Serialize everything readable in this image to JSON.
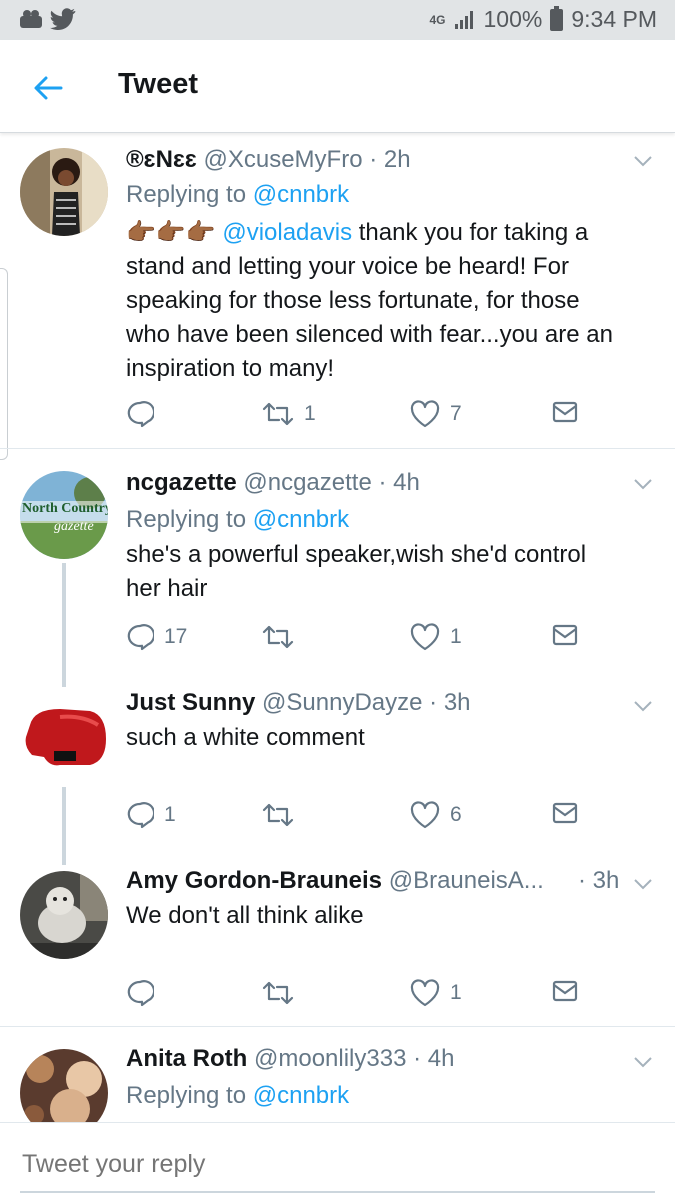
{
  "status_bar": {
    "network": "4G",
    "battery": "100%",
    "time": "9:34 PM"
  },
  "header": {
    "title": "Tweet"
  },
  "tweets": [
    {
      "name": "®ɛNɛɛ",
      "handle": "@XcuseMyFro",
      "time": "· 2h",
      "reply_prefix": "Replying to",
      "reply_to": "@cnnbrk",
      "emoji": "👉🏾👉🏾👉🏾",
      "mention": "@violadavis",
      "text_after_mention": " thank you for taking a",
      "text_lines": [
        "stand and letting your voice be heard! For",
        "speaking for those less fortunate, for those",
        "who have been silenced with fear...you are an",
        "inspiration to many!"
      ],
      "reply_count": "",
      "retweet_count": "1",
      "like_count": "7"
    },
    {
      "name": "ncgazette",
      "handle": "@ncgazette",
      "time": "· 4h",
      "reply_prefix": "Replying to",
      "reply_to": "@cnnbrk",
      "avatar_text_1": "North Country",
      "avatar_text_2": "gazette",
      "text_lines": [
        "she's a powerful speaker,wish she'd control",
        "her hair"
      ],
      "reply_count": "17",
      "retweet_count": "",
      "like_count": "1"
    },
    {
      "name": "Just Sunny",
      "handle": "@SunnyDayze",
      "time": "· 3h",
      "text_lines": [
        "such a white comment"
      ],
      "reply_count": "1",
      "retweet_count": "",
      "like_count": "6"
    },
    {
      "name": "Amy Gordon-Brauneis",
      "handle": "@BrauneisA...",
      "time": "· 3h",
      "text_lines": [
        "We don't all think alike"
      ],
      "reply_count": "",
      "retweet_count": "",
      "like_count": "1"
    },
    {
      "name": "Anita Roth",
      "handle": "@moonlily333",
      "time": "· 4h",
      "reply_prefix": "Replying to",
      "reply_to": "@cnnbrk"
    }
  ],
  "reply_bar": {
    "placeholder": "Tweet your reply"
  },
  "colors": {
    "accent": "#1da1f2",
    "secondary_text": "#657786",
    "status_bar": "#e1e4e6"
  },
  "icons": [
    "back-arrow-icon",
    "reply-icon",
    "retweet-icon",
    "like-icon",
    "dm-icon",
    "chevron-down-icon"
  ]
}
